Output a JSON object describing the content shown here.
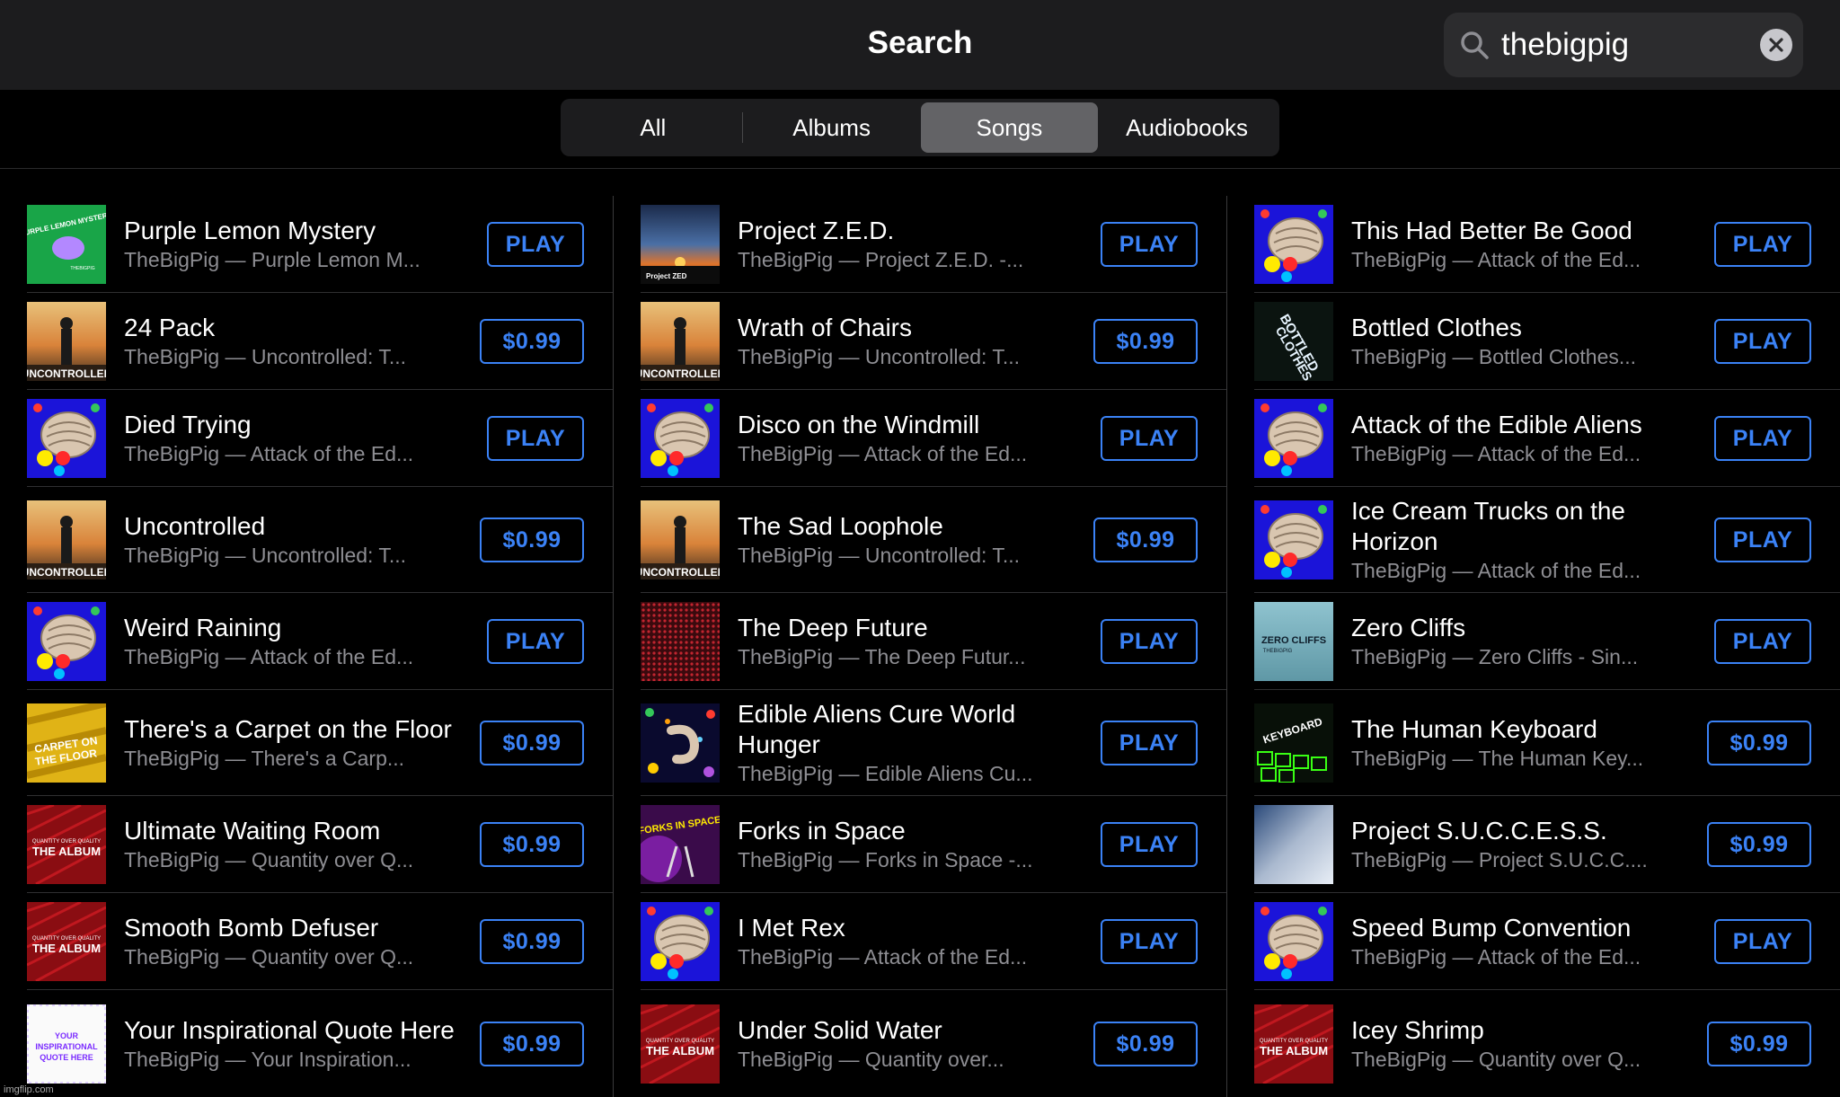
{
  "header": {
    "title": "Search"
  },
  "search": {
    "value": "thebigpig",
    "placeholder": ""
  },
  "tabs": [
    {
      "label": "All",
      "active": false
    },
    {
      "label": "Albums",
      "active": false
    },
    {
      "label": "Songs",
      "active": true
    },
    {
      "label": "Audiobooks",
      "active": false
    }
  ],
  "columns": [
    [
      {
        "title": "Purple Lemon Mystery",
        "subtitle": "TheBigPig — Purple Lemon M...",
        "action": "PLAY",
        "art": "purple-lemon"
      },
      {
        "title": "24 Pack",
        "subtitle": "TheBigPig — Uncontrolled: T...",
        "action": "$0.99",
        "art": "uncontrolled"
      },
      {
        "title": "Died Trying",
        "subtitle": "TheBigPig — Attack of the Ed...",
        "action": "PLAY",
        "art": "aliens"
      },
      {
        "title": "Uncontrolled",
        "subtitle": "TheBigPig — Uncontrolled: T...",
        "action": "$0.99",
        "art": "uncontrolled"
      },
      {
        "title": "Weird Raining",
        "subtitle": "TheBigPig — Attack of the Ed...",
        "action": "PLAY",
        "art": "aliens"
      },
      {
        "title": "There's a Carpet on the Floor",
        "subtitle": "TheBigPig — There's a Carp...",
        "action": "$0.99",
        "art": "carpet"
      },
      {
        "title": "Ultimate Waiting Room",
        "subtitle": "TheBigPig — Quantity over Q...",
        "action": "$0.99",
        "art": "the-album"
      },
      {
        "title": "Smooth Bomb Defuser",
        "subtitle": "TheBigPig — Quantity over Q...",
        "action": "$0.99",
        "art": "the-album"
      },
      {
        "title": "Your Inspirational Quote Here",
        "subtitle": "TheBigPig — Your Inspiration...",
        "action": "$0.99",
        "art": "quote"
      }
    ],
    [
      {
        "title": "Project Z.E.D.",
        "subtitle": "TheBigPig — Project Z.E.D. -...",
        "action": "PLAY",
        "art": "zed"
      },
      {
        "title": "Wrath of Chairs",
        "subtitle": "TheBigPig — Uncontrolled: T...",
        "action": "$0.99",
        "art": "uncontrolled"
      },
      {
        "title": "Disco on the Windmill",
        "subtitle": "TheBigPig — Attack of the Ed...",
        "action": "PLAY",
        "art": "aliens"
      },
      {
        "title": "The Sad Loophole",
        "subtitle": "TheBigPig — Uncontrolled: T...",
        "action": "$0.99",
        "art": "uncontrolled"
      },
      {
        "title": "The Deep Future",
        "subtitle": "TheBigPig — The Deep Futur...",
        "action": "PLAY",
        "art": "deep-future"
      },
      {
        "title": "Edible Aliens Cure World Hunger",
        "subtitle": "TheBigPig — Edible Aliens Cu...",
        "action": "PLAY",
        "art": "cure"
      },
      {
        "title": "Forks in Space",
        "subtitle": "TheBigPig — Forks in Space -...",
        "action": "PLAY",
        "art": "forks"
      },
      {
        "title": "I Met Rex",
        "subtitle": "TheBigPig — Attack of the Ed...",
        "action": "PLAY",
        "art": "aliens"
      },
      {
        "title": "Under Solid Water",
        "subtitle": "TheBigPig — Quantity over...",
        "action": "$0.99",
        "art": "the-album"
      }
    ],
    [
      {
        "title": "This Had Better Be Good",
        "subtitle": "TheBigPig — Attack of the Ed...",
        "action": "PLAY",
        "art": "aliens"
      },
      {
        "title": "Bottled Clothes",
        "subtitle": "TheBigPig — Bottled Clothes...",
        "action": "PLAY",
        "art": "bottled"
      },
      {
        "title": "Attack of the Edible Aliens",
        "subtitle": "TheBigPig — Attack of the Ed...",
        "action": "PLAY",
        "art": "aliens"
      },
      {
        "title": "Ice Cream Trucks on the Horizon",
        "subtitle": "TheBigPig — Attack of the Ed...",
        "action": "PLAY",
        "art": "aliens"
      },
      {
        "title": "Zero Cliffs",
        "subtitle": "TheBigPig — Zero Cliffs - Sin...",
        "action": "PLAY",
        "art": "zero-cliffs"
      },
      {
        "title": "The Human Keyboard",
        "subtitle": "TheBigPig — The Human Key...",
        "action": "$0.99",
        "art": "keyboard"
      },
      {
        "title": "Project S.U.C.C.E.S.S.",
        "subtitle": "TheBigPig — Project S.U.C.C....",
        "action": "$0.99",
        "art": "success"
      },
      {
        "title": "Speed Bump Convention",
        "subtitle": "TheBigPig — Attack of the Ed...",
        "action": "PLAY",
        "art": "aliens"
      },
      {
        "title": "Icey Shrimp",
        "subtitle": "TheBigPig — Quantity over Q...",
        "action": "$0.99",
        "art": "the-album"
      }
    ]
  ],
  "art_text": {
    "purple_lemon": "PURPLE LEMON MYSTERY",
    "purple_lemon_by": "THEBIGPIG",
    "uncontrolled": "UNCONTROLLED",
    "the_album": "THE ALBUM",
    "the_album_sub": "QUANTITY OVER QUALITY",
    "zed": "Project ZED",
    "bottled": "BOTTLED CLOTHES",
    "zero_cliffs": "ZERO CLIFFS",
    "zero_cliffs_by": "THEBIGPIG",
    "keyboard": "KEYBOARD",
    "carpet": "CARPET ON THE FLOOR",
    "forks": "FORKS IN SPACE",
    "quote": "YOUR INSPIRATIONAL QUOTE HERE",
    "brand": "TheBigPig"
  },
  "colors": {
    "accent": "#3b82f6",
    "background": "#000000",
    "topbar": "#1c1c1e"
  },
  "watermark": "imgflip.com"
}
